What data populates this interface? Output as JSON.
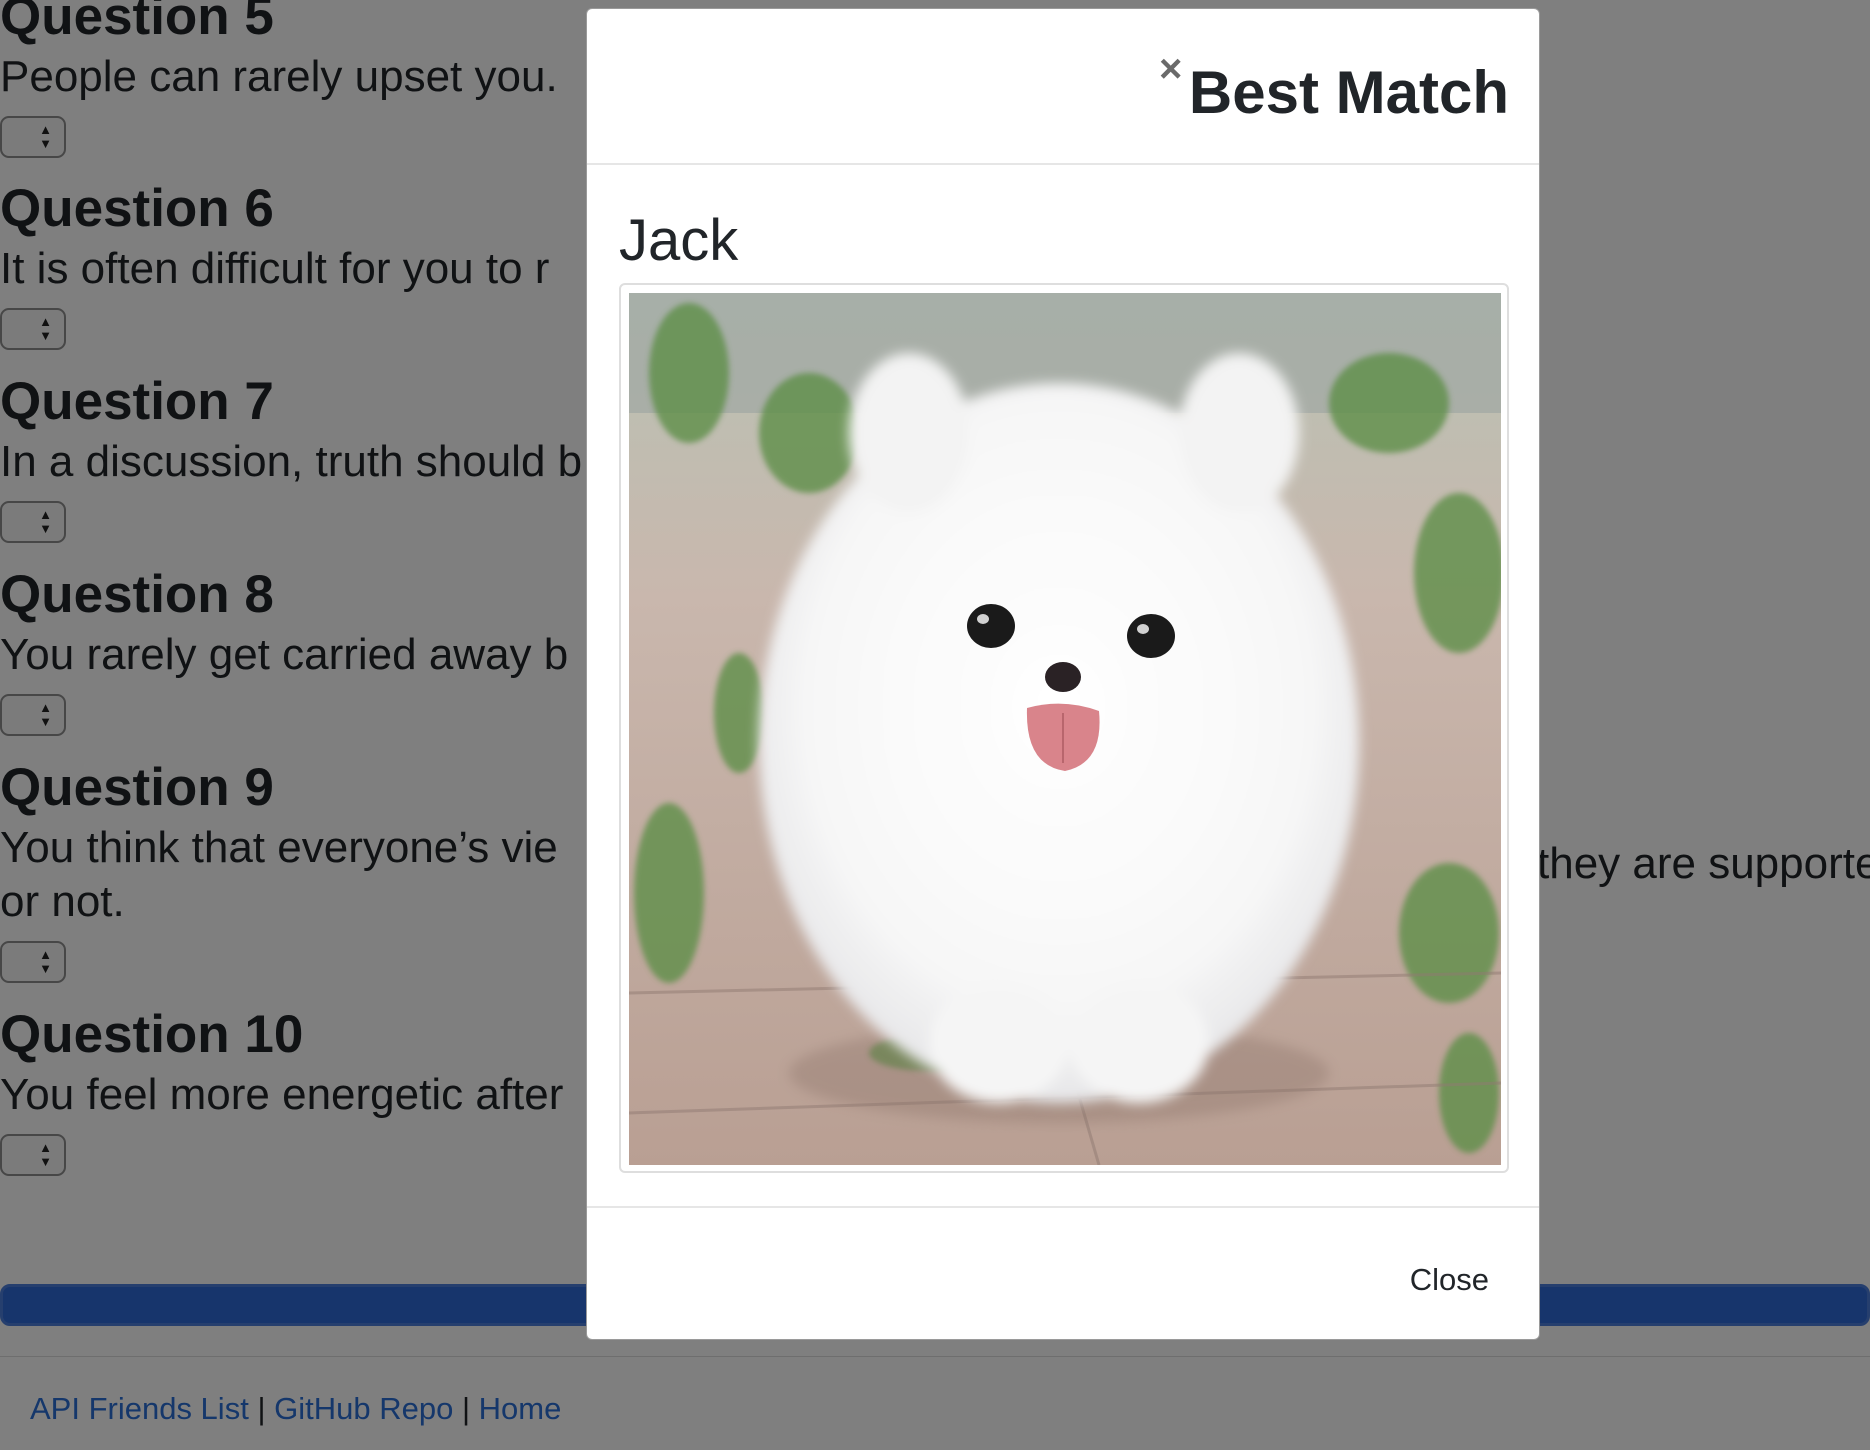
{
  "questions": [
    {
      "title": "Question 5",
      "text": "People can rarely upset you."
    },
    {
      "title": "Question 6",
      "text": "It is often difficult for you to r"
    },
    {
      "title": "Question 7",
      "text": "In a discussion, truth should b"
    },
    {
      "title": "Question 8",
      "text": "You rarely get carried away b"
    },
    {
      "title": "Question 9",
      "text": "You think that everyone’s vie",
      "text_right": "they are supporte",
      "text_line2": "or not."
    },
    {
      "title": "Question 10",
      "text": "You feel more energetic after"
    }
  ],
  "footer": {
    "link1": "API Friends List",
    "link2": "GitHub Repo",
    "link3": "Home",
    "separator": "|"
  },
  "modal": {
    "close_icon": "×",
    "title": "Best Match",
    "match_name": "Jack",
    "photo_alt": "white fluffy puppy",
    "close_label": "Close"
  },
  "colors": {
    "submit_bar": "#2f6bd9",
    "link": "#2a6fd6",
    "backdrop": "rgba(0,0,0,0.5)"
  }
}
